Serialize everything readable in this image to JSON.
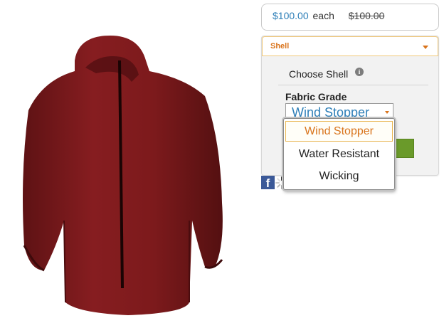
{
  "price": {
    "current": "$100.00",
    "unit": "each",
    "original": "$100.00"
  },
  "shell_panel": {
    "title": "Shell",
    "choose_label": "Choose Shell",
    "info_icon": "i",
    "fabric_grade_label": "Fabric Grade",
    "selected_value": "Wind Stopper"
  },
  "dropdown": {
    "options": [
      "Wind Stopper",
      "Water Resistant",
      "Wicking"
    ],
    "selected_index": 0
  },
  "share": {
    "facebook_glyph": "f",
    "icons": [
      "facebook-icon",
      "loading-spinner-icon",
      "email-icon"
    ]
  },
  "colors": {
    "accent_orange": "#d9741c",
    "link_blue": "#2e7fb8",
    "jacket_red": "#7d1a1c",
    "button_green": "#6a9a2a",
    "facebook_blue": "#3b5998"
  },
  "product": {
    "image_icon": "hooded-jacket-image"
  }
}
